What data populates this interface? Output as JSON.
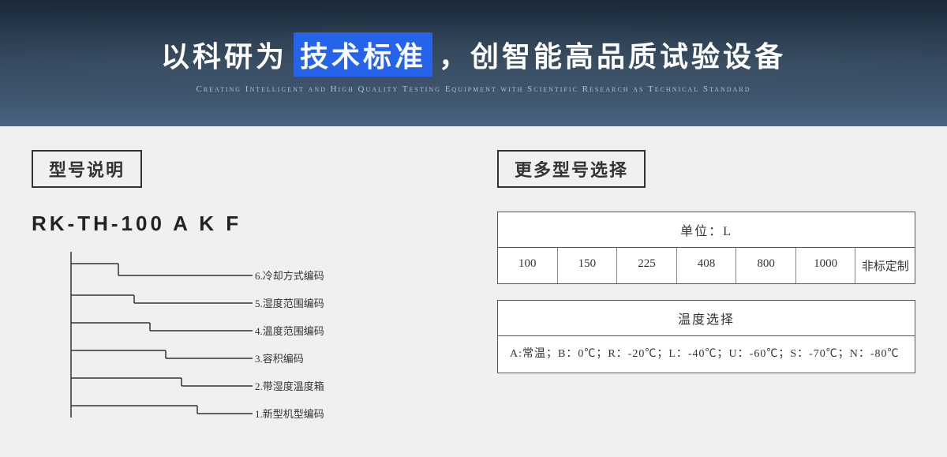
{
  "hero": {
    "title_prefix": "以科研为",
    "title_highlight": "技术标准",
    "title_suffix": "，创智能高品质试验设备",
    "subtitle": "Creating Intelligent and High Quality Testing Equipment with Scientific Research as Technical Standard"
  },
  "left_section": {
    "section_title": "型号说明",
    "model_label": "RK-TH-100  A  K  F",
    "diagram_items": [
      {
        "number": "6",
        "label": "冷却方式编码"
      },
      {
        "number": "5",
        "label": "湿度范围编码"
      },
      {
        "number": "4",
        "label": "温度范围编码"
      },
      {
        "number": "3",
        "label": "容积编码"
      },
      {
        "number": "2",
        "label": "带湿度温度箱"
      },
      {
        "number": "1",
        "label": "新型机型编码"
      }
    ]
  },
  "right_section": {
    "section_title": "更多型号选择",
    "volume_table": {
      "header": "单位：L",
      "cells": [
        "100",
        "150",
        "225",
        "408",
        "800",
        "1000",
        "非标定制"
      ]
    },
    "temp_table": {
      "header": "温度选择",
      "body": "A:常温；B：0℃；R：-20℃；L：-40℃；U：-60℃；S：-70℃；N：-80℃"
    }
  }
}
